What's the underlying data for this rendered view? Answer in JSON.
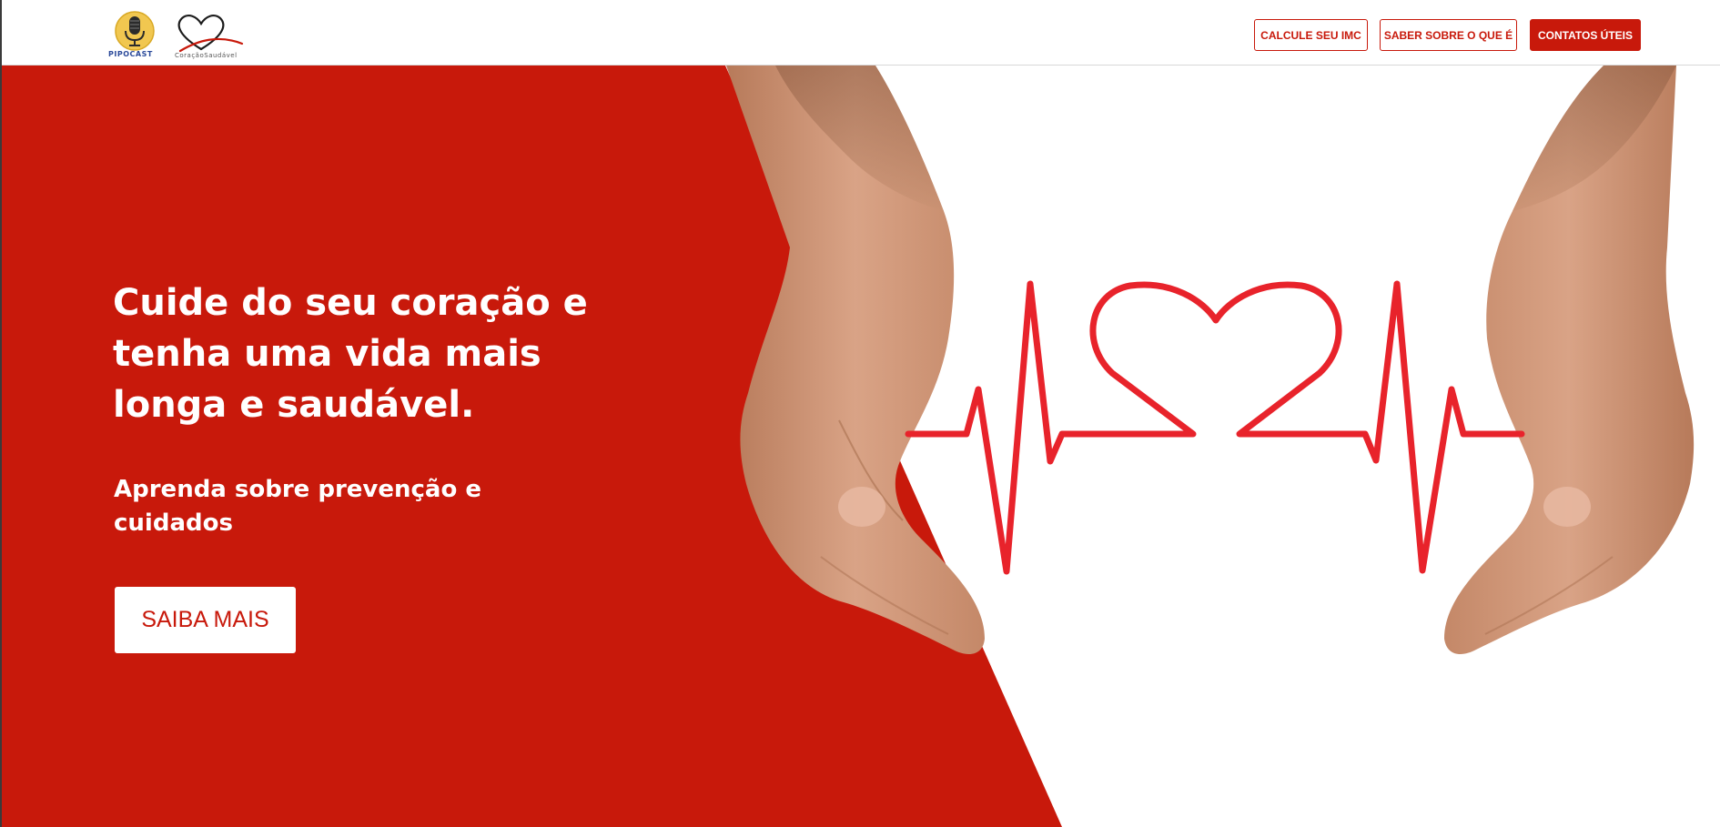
{
  "header": {
    "logos": {
      "podcast_logo_name": "podcast-microphone-logo",
      "podcast_logo_caption": "PIPOCAST",
      "heart_logo_name": "heart-ribbon-logo",
      "heart_logo_caption": "CoraçãoSaudável"
    },
    "nav": [
      {
        "label": "CALCULE SEU IMC",
        "style": "outline"
      },
      {
        "label": "SABER SOBRE O QUE É",
        "style": "outline"
      },
      {
        "label": "CONTATOS ÚTEIS",
        "style": "filled"
      }
    ]
  },
  "hero": {
    "title": "Cuide do seu coração e tenha uma vida mais longa e saudável.",
    "subtitle": "Aprenda sobre prevenção e cuidados",
    "cta_label": "SAIBA MAIS",
    "illustration": "hands-cradling-heartbeat-line"
  },
  "colors": {
    "brand_red": "#c8190b",
    "heartbeat_red": "#e8232b",
    "background": "#ffffff",
    "text_on_red": "#ffffff"
  }
}
